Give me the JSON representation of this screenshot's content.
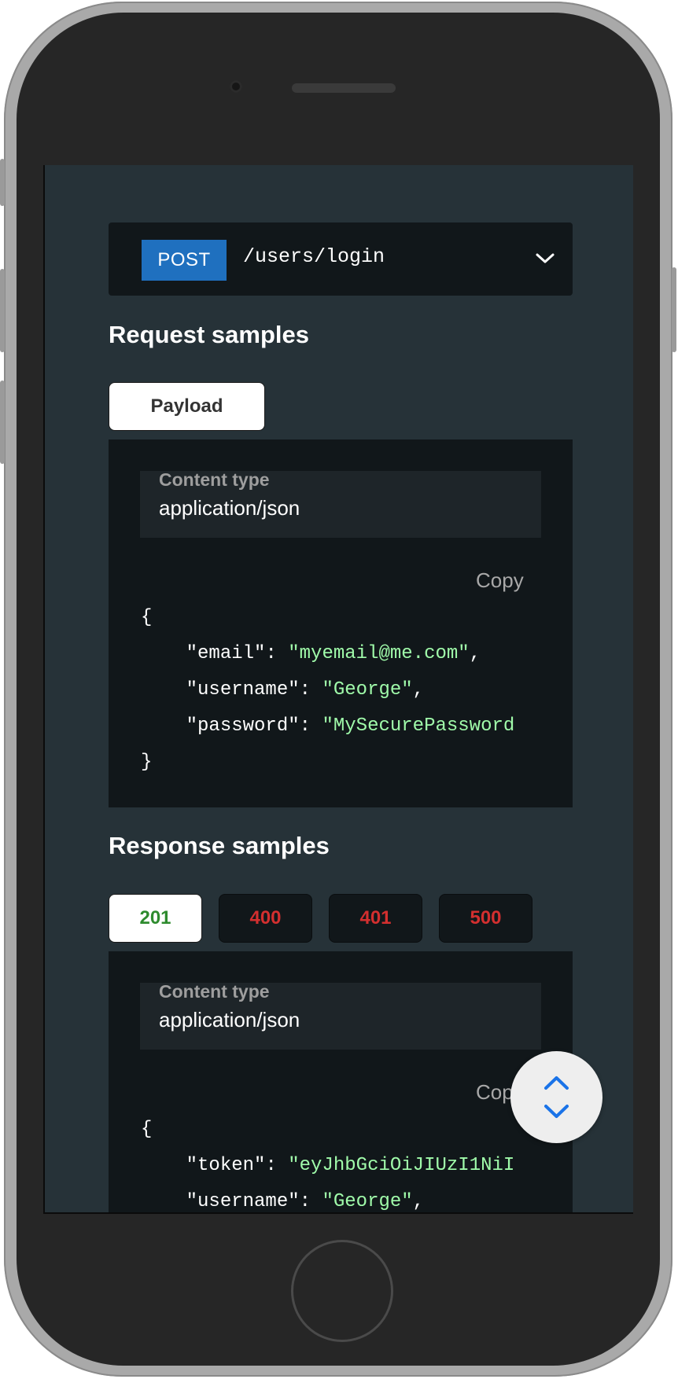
{
  "endpoint": {
    "method": "POST",
    "path": "/users/login"
  },
  "request": {
    "title": "Request samples",
    "tabs": [
      {
        "label": "Payload",
        "active": true
      }
    ],
    "content_type_label": "Content type",
    "content_type_value": "application/json",
    "copy_label": "Copy",
    "code": {
      "open": "{",
      "lines": [
        {
          "key": "\"email\"",
          "value": "\"myemail@me.com\"",
          "tail": ","
        },
        {
          "key": "\"username\"",
          "value": "\"George\"",
          "tail": ","
        },
        {
          "key": "\"password\"",
          "value": "\"MySecurePassword",
          "tail": ""
        }
      ],
      "close": "}"
    }
  },
  "response": {
    "title": "Response samples",
    "tabs": [
      {
        "label": "201",
        "active": true
      },
      {
        "label": "400",
        "active": false
      },
      {
        "label": "401",
        "active": false
      },
      {
        "label": "500",
        "active": false
      }
    ],
    "content_type_label": "Content type",
    "content_type_value": "application/json",
    "copy_label": "Copy",
    "code": {
      "open": "{",
      "lines": [
        {
          "key": "\"token\"",
          "value": "\"eyJhbGciOiJIUzI1NiI",
          "tail": ""
        },
        {
          "key": "\"username\"",
          "value": "\"George\"",
          "tail": ","
        }
      ]
    }
  },
  "colors": {
    "method_bg": "#1f70bf",
    "string": "#a0fbaa",
    "error_tab": "#d32f2f",
    "success_tab": "#2e8b2e",
    "fab_icon": "#1a73e8"
  },
  "icons": {
    "endpoint_toggle": "chevron-down-icon",
    "scroll_fab": "unfold-icon"
  }
}
